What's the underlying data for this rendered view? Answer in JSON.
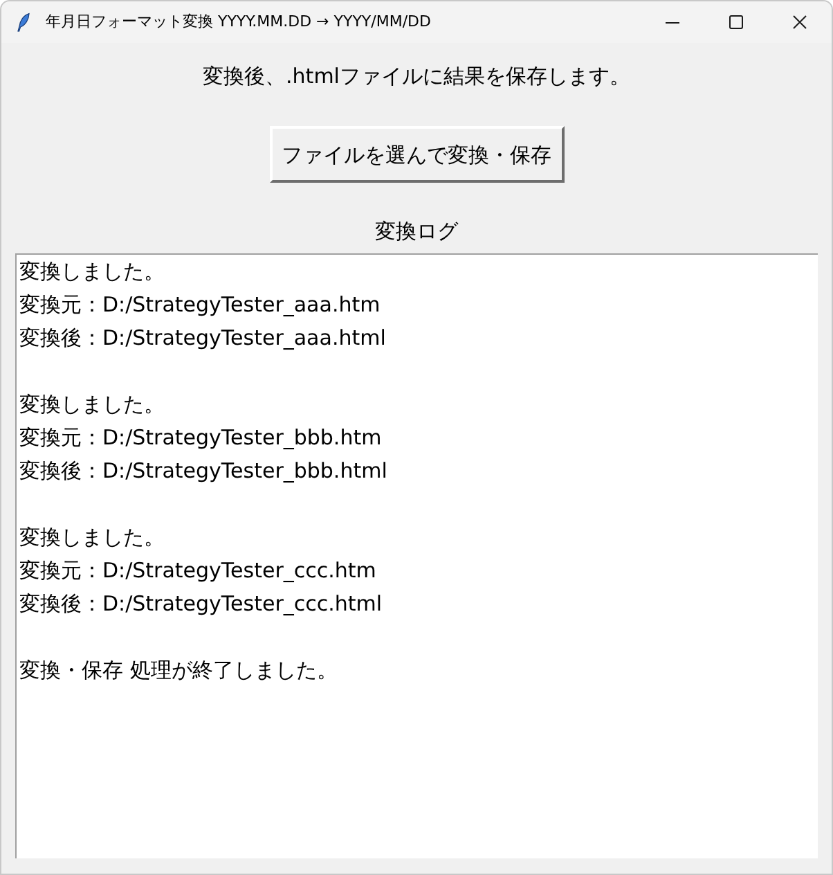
{
  "window": {
    "title": "年月日フォーマット変換 YYYY.MM.DD → YYYY/MM/DD"
  },
  "instruction": "変換後、.htmlファイルに結果を保存します。",
  "button": {
    "label": "ファイルを選んで変換・保存"
  },
  "log": {
    "label": "変換ログ",
    "entries": [
      {
        "lines": [
          "変換しました。",
          "変換元：D:/StrategyTester_aaa.htm",
          "変換後：D:/StrategyTester_aaa.html"
        ]
      },
      {
        "lines": [
          "変換しました。",
          "変換元：D:/StrategyTester_bbb.htm",
          "変換後：D:/StrategyTester_bbb.html"
        ]
      },
      {
        "lines": [
          "変換しました。",
          "変換元：D:/StrategyTester_ccc.htm",
          "変換後：D:/StrategyTester_ccc.html"
        ]
      },
      {
        "lines": [
          "変換・保存 処理が終了しました。"
        ]
      }
    ]
  }
}
